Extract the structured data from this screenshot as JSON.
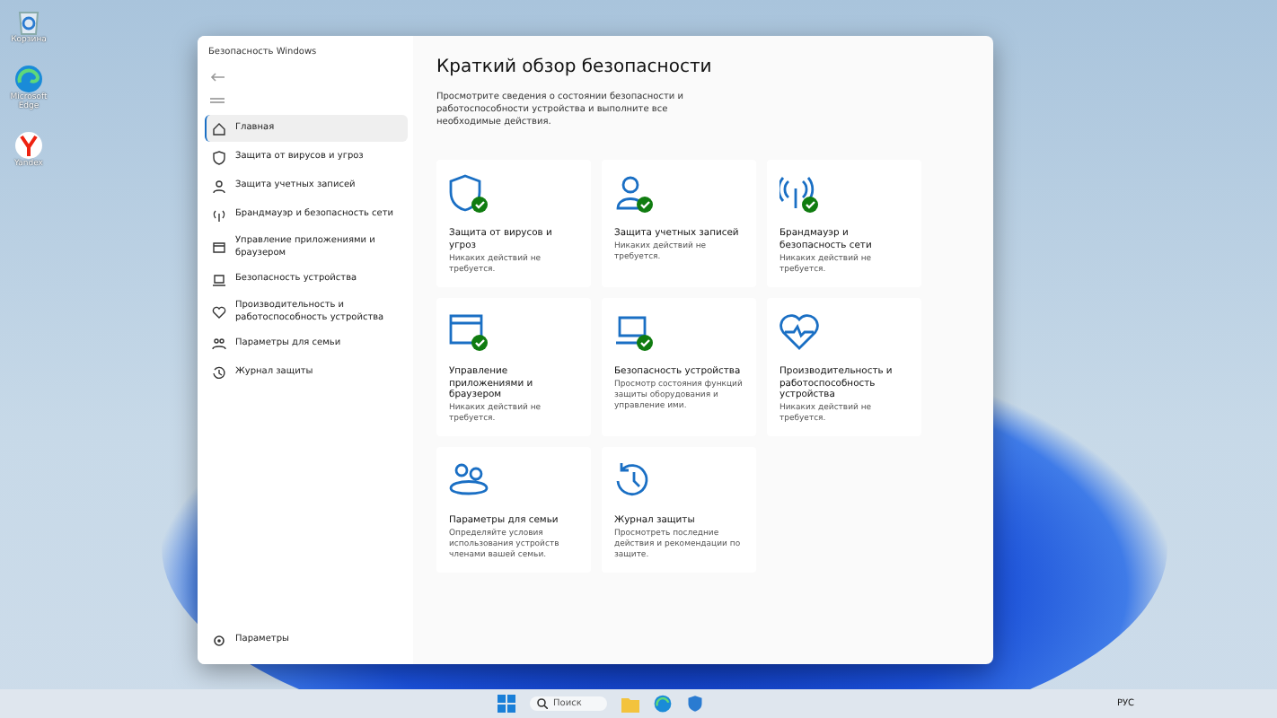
{
  "desktop_icons": [
    {
      "kind": "recycle",
      "label": "Корзина"
    },
    {
      "kind": "edge",
      "label": "Microsoft Edge"
    },
    {
      "kind": "yandex",
      "label": "Yandex"
    }
  ],
  "window": {
    "title": "Безопасность Windows"
  },
  "sidebar": {
    "items": [
      {
        "kind": "home",
        "label": "Главная",
        "selected": true
      },
      {
        "kind": "shield",
        "label": "Защита от вирусов и угроз",
        "selected": false
      },
      {
        "kind": "person",
        "label": "Защита учетных записей",
        "selected": false
      },
      {
        "kind": "wifi",
        "label": "Брандмауэр и безопасность сети",
        "selected": false
      },
      {
        "kind": "browser",
        "label": "Управление приложениями и браузером",
        "selected": false
      },
      {
        "kind": "laptop",
        "label": "Безопасность устройства",
        "selected": false
      },
      {
        "kind": "heart",
        "label": "Производительность и работоспособность устройства",
        "selected": false
      },
      {
        "kind": "family",
        "label": "Параметры для семьи",
        "selected": false
      },
      {
        "kind": "history",
        "label": "Журнал защиты",
        "selected": false
      }
    ],
    "settings": "Параметры"
  },
  "main": {
    "heading": "Краткий обзор безопасности",
    "intro": "Просмотрите сведения о состоянии безопасности и работоспособности устройства и выполните все необходимые действия.",
    "cards": [
      {
        "kind": "shield",
        "title": "Защита от вирусов и угроз",
        "status": "Никаких действий не требуется.",
        "ok": true
      },
      {
        "kind": "person",
        "title": "Защита учетных записей",
        "status": "Никаких действий не требуется.",
        "ok": true
      },
      {
        "kind": "wifi",
        "title": "Брандмауэр и безопасность сети",
        "status": "Никаких действий не требуется.",
        "ok": true
      },
      {
        "kind": "browser",
        "title": "Управление приложениями и браузером",
        "status": "Никаких действий не требуется.",
        "ok": true
      },
      {
        "kind": "laptop",
        "title": "Безопасность устройства",
        "status": "Просмотр состояния функций защиты оборудования и управление ими.",
        "ok": true
      },
      {
        "kind": "heart",
        "title": "Производительность и работоспособность устройства",
        "status": "Никаких действий не требуется.",
        "ok": false
      },
      {
        "kind": "family",
        "title": "Параметры для семьи",
        "status": "Определяйте условия использования устройств членами вашей семьи.",
        "ok": false
      },
      {
        "kind": "history",
        "title": "Журнал защиты",
        "status": "Просмотреть последние действия и рекомендации по защите.",
        "ok": false
      }
    ]
  },
  "taskbar": {
    "search_placeholder": "Поиск",
    "language": "РУС"
  }
}
